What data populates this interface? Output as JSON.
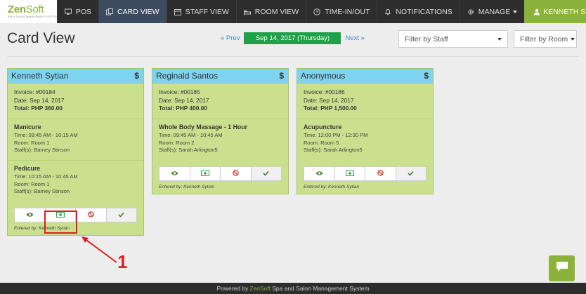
{
  "brand": {
    "name_a": "Zen",
    "name_b": "Soft",
    "tagline": "SPA & SALON MANAGEMENT SYSTEM"
  },
  "nav": {
    "items": [
      {
        "label": "POS",
        "icon": "monitor-icon"
      },
      {
        "label": "CARD VIEW",
        "icon": "cards-icon"
      },
      {
        "label": "STAFF VIEW",
        "icon": "calendar-icon"
      },
      {
        "label": "ROOM VIEW",
        "icon": "bed-icon"
      },
      {
        "label": "TIME-IN/OUT",
        "icon": "clock-icon"
      },
      {
        "label": "NOTIFICATIONS",
        "icon": "bell-icon"
      },
      {
        "label": "MANAGE",
        "icon": "gear-icon"
      }
    ],
    "user": "KENNETH SYTIAN"
  },
  "page": {
    "title": "Card View",
    "prev": "« Prev",
    "next": "Next »",
    "date": "Sep 14, 2017 (Thursday)",
    "filter_staff": "Filter by Staff",
    "filter_room": "Filter by Room"
  },
  "cards": [
    {
      "customer": "Kenneth Sytian",
      "currency_icon": "$",
      "invoice": "Invoice: #00184",
      "date": "Date: Sep 14, 2017",
      "total": "Total: PHP 360.00",
      "services": [
        {
          "name": "Manicure",
          "time": "Time: 09:45 AM - 10:15 AM",
          "room": "Room: Room 1",
          "staff": "Staff(s): Barney Stinson"
        },
        {
          "name": "Pedicure",
          "time": "Time: 10:15 AM - 10:45 AM",
          "room": "Room: Room 1",
          "staff": "Staff(s): Barney Stinson"
        }
      ],
      "entered_by": "Entered by: Kenneth Sytian"
    },
    {
      "customer": "Reginald Santos",
      "currency_icon": "$",
      "invoice": "Invoice: #00185",
      "date": "Date: Sep 14, 2017",
      "total": "Total: PHP 400.00",
      "services": [
        {
          "name": "Whole Body Massage - 1 Hour",
          "time": "Time: 09:45 AM - 10:45 AM",
          "room": "Room: Room 2",
          "staff": "Staff(s): Sarah Arlington5"
        }
      ],
      "entered_by": "Entered by: Kenneth Sytian"
    },
    {
      "customer": "Anonymous",
      "currency_icon": "$",
      "invoice": "Invoice: #00186",
      "date": "Date: Sep 14, 2017",
      "total": "Total: PHP 1,500.00",
      "services": [
        {
          "name": "Acupuncture",
          "time": "Time: 12:00 PM - 12:30 PM",
          "room": "Room: Room 5",
          "staff": "Staff(s): Sarah Arlington5"
        }
      ],
      "entered_by": "Entered by: Kenneth Sytian"
    }
  ],
  "actions": [
    "eye-icon",
    "cash-icon",
    "cancel-icon",
    "check-icon"
  ],
  "annotation": {
    "number": "1"
  },
  "footer": {
    "prefix": "Powered by",
    "brand": "ZenSoft",
    "suffix": "Spa and Salon Management System"
  },
  "colors": {
    "brand_green": "#8bb23a",
    "card_bg": "#cbe08e",
    "card_header": "#7ed4f0",
    "date_pill": "#1ea148",
    "active_nav": "#3c4b5e",
    "annotation_red": "#e01e1e"
  }
}
